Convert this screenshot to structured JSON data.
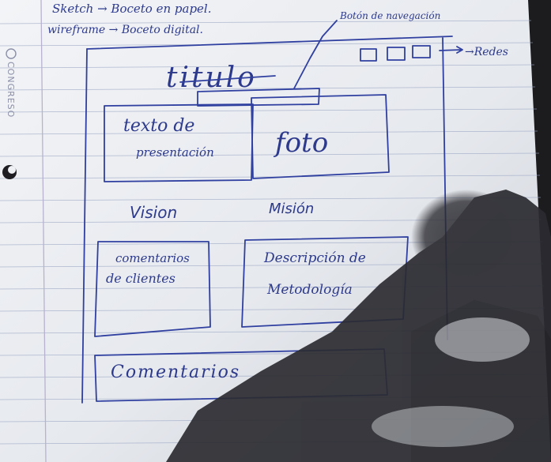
{
  "notes": {
    "line1": "Sketch → Boceto en papel.",
    "line2": "wireframe → Boceto digital."
  },
  "annotations": {
    "nav_buttons": "Botón de navegación",
    "social": "→Redes"
  },
  "wireframe": {
    "title": "titulo",
    "presentation_text_line1": "texto de",
    "presentation_text_line2": "presentación",
    "photo": "foto",
    "vision": "Vision",
    "mission": "Misión",
    "client_comments_line1": "comentarios",
    "client_comments_line2": "de clientes",
    "methodology_line1": "Descripción de",
    "methodology_line2": "Metodología",
    "comments": "Comentarios"
  },
  "notebook_brand": "CONGRESO",
  "colors": {
    "paper": "#eceff3",
    "ink": "#2d3a8c",
    "rule": "#9aa6c4",
    "shadow": "#2a2a30"
  }
}
